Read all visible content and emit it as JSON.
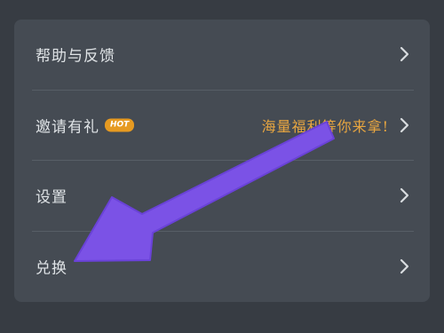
{
  "menu": {
    "items": [
      {
        "label": "帮助与反馈"
      },
      {
        "label": "邀请有礼",
        "badge": "HOT",
        "promo": "海量福利等你来拿!"
      },
      {
        "label": "设置"
      },
      {
        "label": "兑换"
      }
    ]
  },
  "icons": {
    "chevron": "chevron-right-icon",
    "annotation": "arrow-annotation-icon"
  },
  "colors": {
    "background": "#373c43",
    "card": "#454b53",
    "text": "#dfe3e6",
    "accent": "#e8a640",
    "badge": "#e69a21",
    "annotation_arrow": "#7b52e6"
  }
}
